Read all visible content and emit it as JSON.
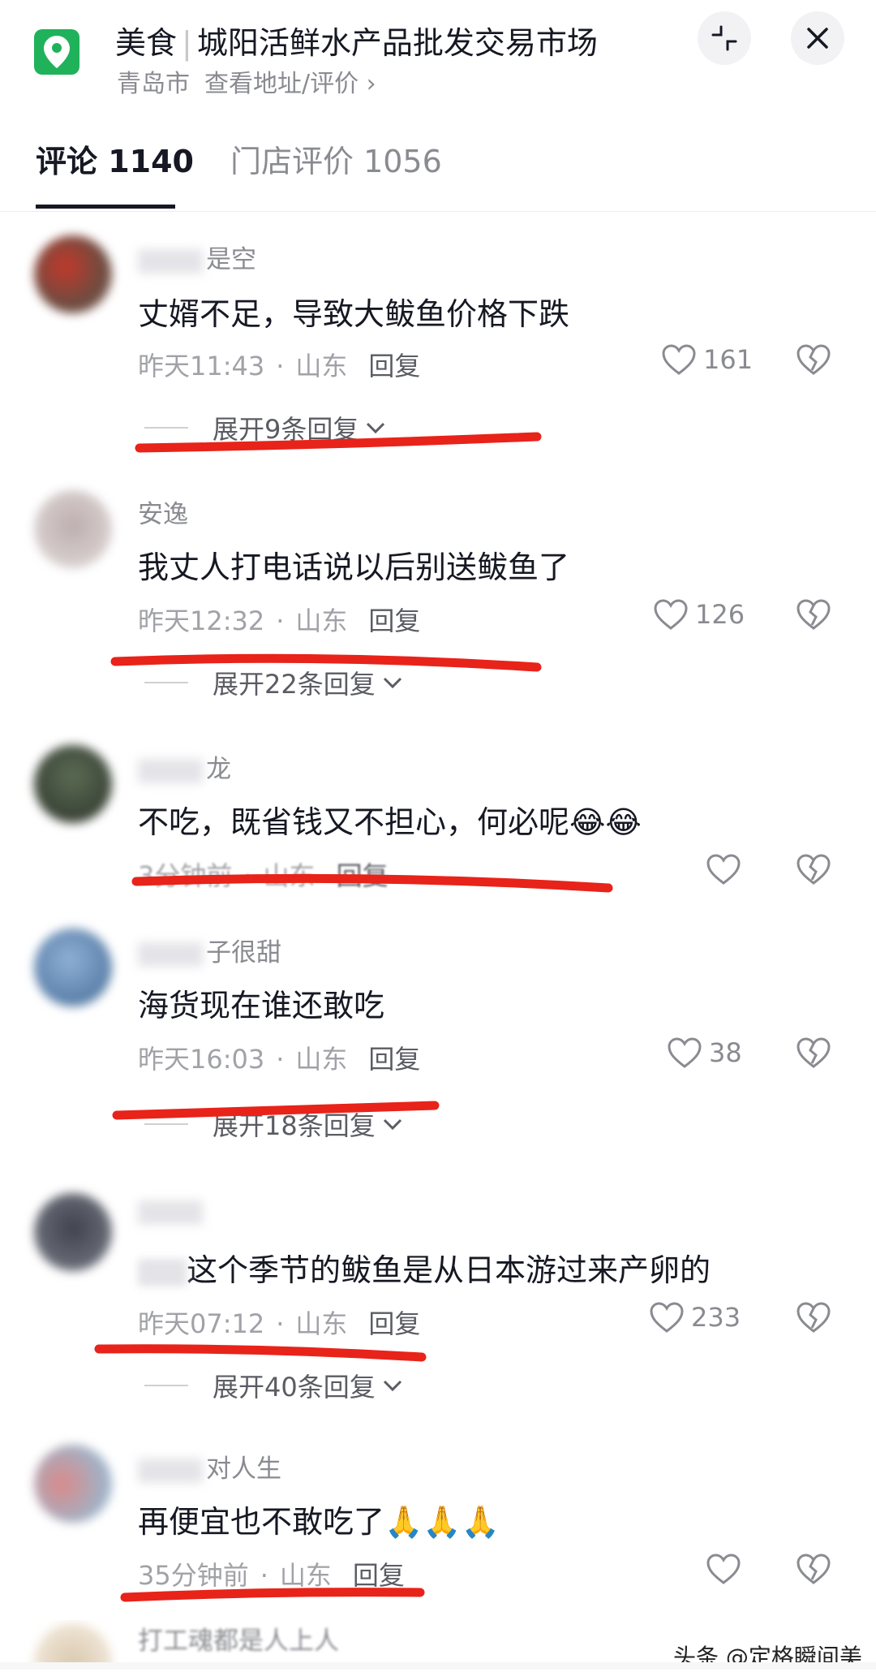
{
  "header": {
    "category": "美食",
    "place_name": "城阳活鲜水产品批发交易市场",
    "city": "青岛市",
    "address_link": "查看地址/评价 ›",
    "minimize_icon": "minimize-icon",
    "close_icon": "close-icon"
  },
  "tabs": [
    {
      "label": "评论 1140",
      "active": true
    },
    {
      "label": "门店评价 1056",
      "active": false
    }
  ],
  "comments": [
    {
      "username": "是空",
      "text": "丈婿不足，导致大鲅鱼价格下跌",
      "time": "昨天11:43",
      "location": "山东",
      "reply": "回复",
      "likes": "161",
      "expand": "展开9条回复"
    },
    {
      "username": "安逸",
      "text": "我丈人打电话说以后别送鲅鱼了",
      "time": "昨天12:32",
      "location": "山东",
      "reply": "回复",
      "likes": "126",
      "expand": "展开22条回复"
    },
    {
      "username": "龙",
      "text": "不吃，既省钱又不担心，何必呢",
      "emoji": "😂😂",
      "time": "3分钟前",
      "location": "山东",
      "reply": "回复",
      "likes": "",
      "expand": ""
    },
    {
      "username": "子很甜",
      "text": "海货现在谁还敢吃",
      "time": "昨天16:03",
      "location": "山东",
      "reply": "回复",
      "likes": "38",
      "expand": "展开18条回复"
    },
    {
      "username": "",
      "text": "这个季节的鲅鱼是从日本游过来产卵的",
      "time": "昨天07:12",
      "location": "山东",
      "reply": "回复",
      "likes": "233",
      "expand": "展开40条回复"
    },
    {
      "username": "对人生",
      "text": "再便宜也不敢吃了",
      "emoji": "🙏🙏🙏",
      "time": "35分钟前",
      "location": "山东",
      "reply": "回复",
      "likes": "",
      "expand": ""
    },
    {
      "username": "打工魂都是人上人",
      "text": "",
      "time": "",
      "location": "",
      "reply": "",
      "likes": "",
      "expand": ""
    }
  ],
  "watermark": "头条 @定格瞬间美",
  "colors": {
    "brand_green": "#20b25a",
    "annotation_red": "#e8231a",
    "text_primary": "#161823",
    "text_secondary": "#8a8b91"
  }
}
